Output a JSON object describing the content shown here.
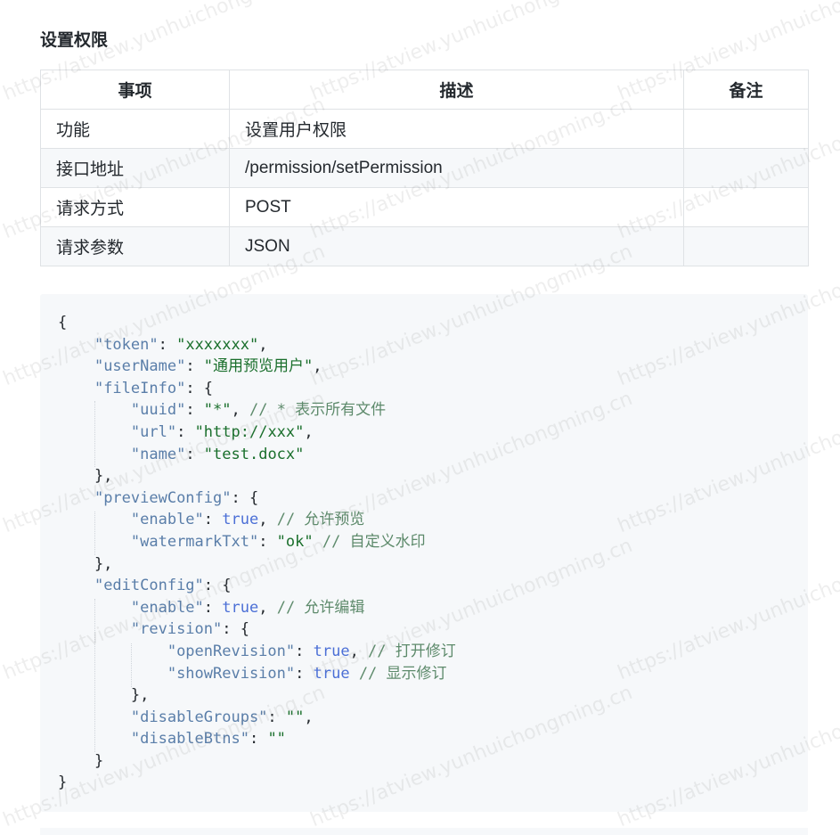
{
  "section_title": "设置权限",
  "table": {
    "headers": [
      "事项",
      "描述",
      "备注"
    ],
    "rows": [
      [
        "功能",
        "设置用户权限",
        ""
      ],
      [
        "接口地址",
        "/permission/setPermission",
        ""
      ],
      [
        "请求方式",
        "POST",
        ""
      ],
      [
        "请求参数",
        "JSON",
        ""
      ]
    ]
  },
  "code_lines": [
    "{",
    "    \"token\": \"xxxxxxx\",",
    "    \"userName\": \"通用预览用户\",",
    "    \"fileInfo\": {",
    "        \"uuid\": \"*\", // * 表示所有文件",
    "        \"url\": \"http://xxx\",",
    "        \"name\": \"test.docx\"",
    "    },",
    "    \"previewConfig\": {",
    "        \"enable\": true, // 允许预览",
    "        \"watermarkTxt\": \"ok\" // 自定义水印",
    "    },",
    "    \"editConfig\": {",
    "        \"enable\": true, // 允许编辑",
    "        \"revision\": {",
    "            \"openRevision\": true, // 打开修订",
    "            \"showRevision\": true // 显示修订",
    "        },",
    "        \"disableGroups\": \"\",",
    "        \"disableBtns\": \"\"",
    "    }",
    "}"
  ],
  "watermark_text": "https://atview.yunhuichongming.cn",
  "colors": {
    "key": "#5a7ea9",
    "string": "#1a6f2c",
    "boolean": "#4b6fd6",
    "comment": "#5d8a6b",
    "code_bg": "#f6f8fa",
    "border": "#dfe2e5"
  }
}
